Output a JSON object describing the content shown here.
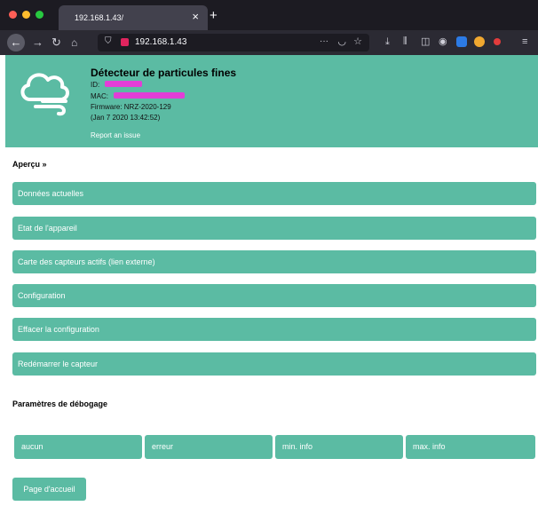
{
  "browser": {
    "tab_title": "192.168.1.43/",
    "tab_close": "×",
    "new_tab": "+",
    "url": "192.168.1.43",
    "more_actions": "···",
    "icons": [
      "back-icon",
      "forward-icon",
      "reload-icon",
      "home-icon",
      "shield-icon",
      "lock-icon",
      "pocket-icon",
      "star-icon",
      "download-icon",
      "library-icon",
      "sidebar-icon",
      "extension-icon"
    ],
    "window_controls": [
      "#fe5f57",
      "#febc2e",
      "#28c840"
    ]
  },
  "device": {
    "title": "Détecteur de particules fines",
    "id_label": "ID:",
    "mac_label": "MAC:",
    "firmware": "Firmware: NRZ-2020-129",
    "build_date": "(Jan 7 2020 13:42:52)",
    "report_link": "Report an issue"
  },
  "overview": {
    "title": "Aperçu »",
    "items": [
      {
        "label": "Données actuelles"
      },
      {
        "label": "Etat de l'appareil"
      },
      {
        "label": "Carte des capteurs actifs (lien externe)"
      },
      {
        "label": "Configuration"
      },
      {
        "label": "Effacer la configuration"
      },
      {
        "label": "Redémarrer le capteur"
      }
    ]
  },
  "debug": {
    "title": "Paramètres de débogage",
    "levels": [
      {
        "label": "aucun"
      },
      {
        "label": "erreur"
      },
      {
        "label": "min. info"
      },
      {
        "label": "max. info"
      }
    ]
  },
  "footer": {
    "home_label": "Page d'accueil"
  },
  "colors": {
    "accent": "#5bbba3",
    "redaction": "#e23ed7"
  }
}
